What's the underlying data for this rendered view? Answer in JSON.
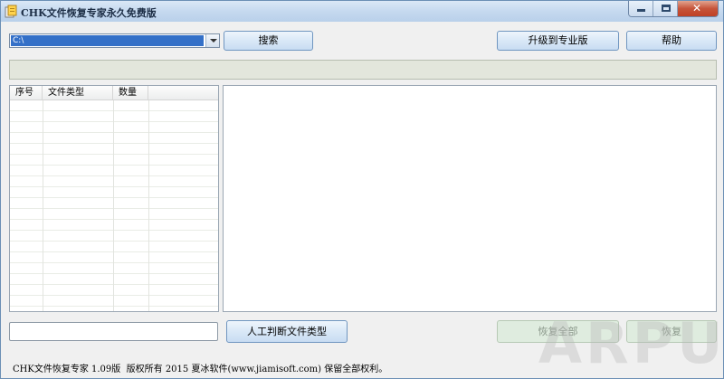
{
  "titlebar": {
    "title": "CHK文件恢复专家永久免费版",
    "min_icon": "minimize-icon",
    "max_icon": "maximize-icon",
    "close_icon": "close-icon",
    "close_glyph": "✕"
  },
  "toolbar": {
    "drive_value": "C:\\",
    "search_label": "搜索",
    "upgrade_label": "升级到专业版",
    "help_label": "帮助"
  },
  "list": {
    "columns": [
      "序号",
      "文件类型",
      "数量"
    ]
  },
  "bottom": {
    "filename_value": "",
    "manual_label": "人工判断文件类型",
    "restore_all_label": "恢复全部",
    "restore_label": "恢复"
  },
  "footer": {
    "text": "CHK文件恢复专家 1.09版  版权所有 2015 夏冰软件(www.jiamisoft.com) 保留全部权利。"
  },
  "watermark": {
    "text": "ARPUN"
  }
}
